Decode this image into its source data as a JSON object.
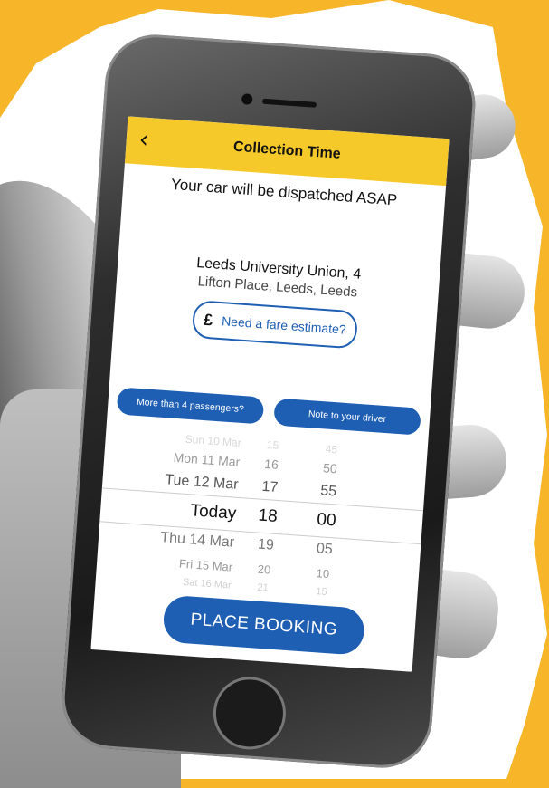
{
  "header": {
    "title": "Collection Time",
    "back_icon": "chevron-left-icon"
  },
  "dispatch_text": "Your car will be dispatched ASAP",
  "address": {
    "line1": "Leeds University Union, 4",
    "line2": "Lifton Place, Leeds, Leeds"
  },
  "fare": {
    "currency_symbol": "£",
    "label": "Need a fare estimate?"
  },
  "buttons": {
    "passengers": "More than 4 passengers?",
    "driver_note": "Note to your driver",
    "place_booking": "PLACE BOOKING"
  },
  "picker": {
    "rows": [
      {
        "day": "Sun 10 Mar",
        "hour": "15",
        "minute": "45"
      },
      {
        "day": "Mon 11 Mar",
        "hour": "16",
        "minute": "50"
      },
      {
        "day": "Tue 12 Mar",
        "hour": "17",
        "minute": "55"
      },
      {
        "day": "Today",
        "hour": "18",
        "minute": "00"
      },
      {
        "day": "Thu 14 Mar",
        "hour": "19",
        "minute": "05"
      },
      {
        "day": "Fri 15 Mar",
        "hour": "20",
        "minute": "10"
      },
      {
        "day": "Sat 16 Mar",
        "hour": "21",
        "minute": "15"
      }
    ],
    "selected_index": 3
  },
  "colors": {
    "background": "#F7B52A",
    "header": "#F6C92B",
    "accent": "#1E5FB4"
  }
}
